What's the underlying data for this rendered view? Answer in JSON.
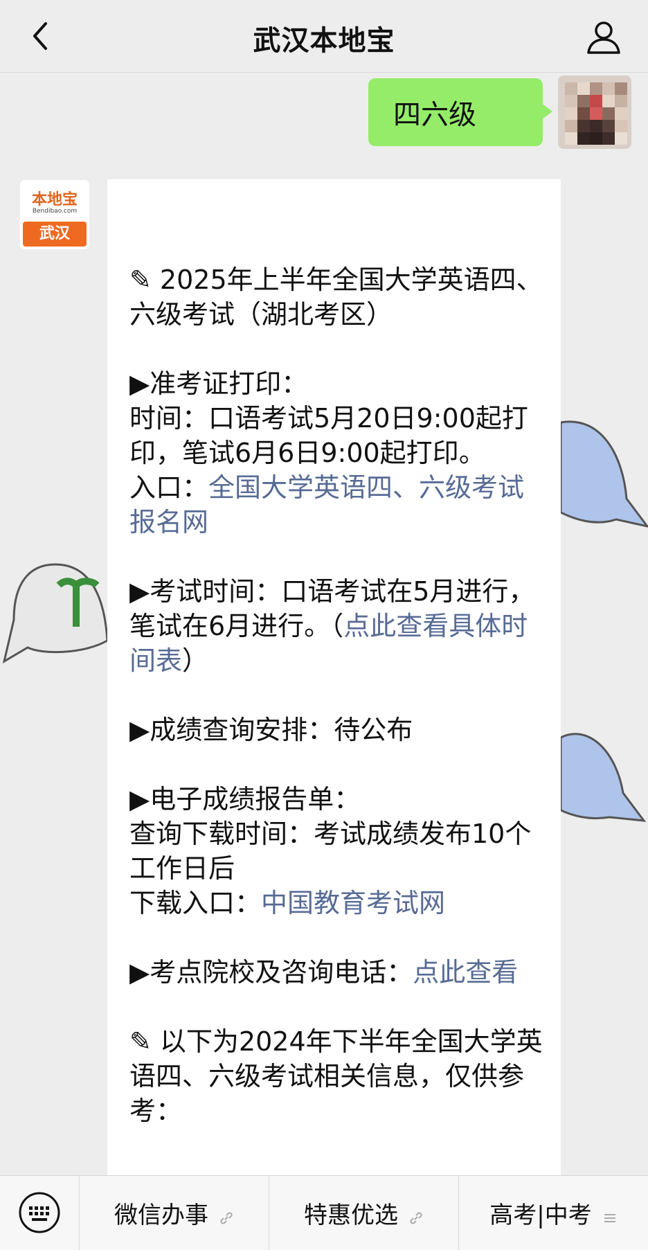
{
  "header": {
    "title": "武汉本地宝",
    "back_icon": "chevron-left-icon",
    "user_icon": "user-icon"
  },
  "chat": {
    "outgoing_message": "四六级",
    "sender_logo": {
      "brand": "本地宝",
      "sub": "Bendibao.com",
      "city": "武汉"
    },
    "reply": {
      "heading": "✎ 2025年上半年全国大学英语四、六级考试（湖北考区）",
      "admit_card_title": "▶准考证打印：",
      "admit_card_time": "时间：口语考试5月20日9:00起打印，笔试6月6日9:00起打印。",
      "admit_card_entry_label": "入口：",
      "admit_card_entry_link": "全国大学英语四、六级考试报名网",
      "exam_time_text": "▶考试时间：口语考试在5月进行，笔试在6月进行。（",
      "exam_time_link": "点此查看具体时间表",
      "exam_time_close": "）",
      "score_query": "▶成绩查询安排：待公布",
      "report_title": "▶电子成绩报告单：",
      "report_time": "查询下载时间：考试成绩发布10个工作日后",
      "report_entry_label": "下载入口：",
      "report_entry_link": "中国教育考试网",
      "venue_label": "▶考点院校及咨询电话：",
      "venue_link": "点此查看",
      "note": "✎ 以下为2024年下半年全国大学英语四、六级考试相关信息，仅供参考："
    }
  },
  "bottom_menu": {
    "keyboard_icon": "keyboard-icon",
    "items": [
      {
        "label": "微信办事",
        "icon": "link-icon"
      },
      {
        "label": "特惠优选",
        "icon": "link-icon"
      },
      {
        "label": "高考|中考",
        "icon": "menu-icon"
      }
    ]
  },
  "colors": {
    "link": "#576b95",
    "bubble_green": "#95ec69",
    "logo_orange": "#ef6a21"
  }
}
